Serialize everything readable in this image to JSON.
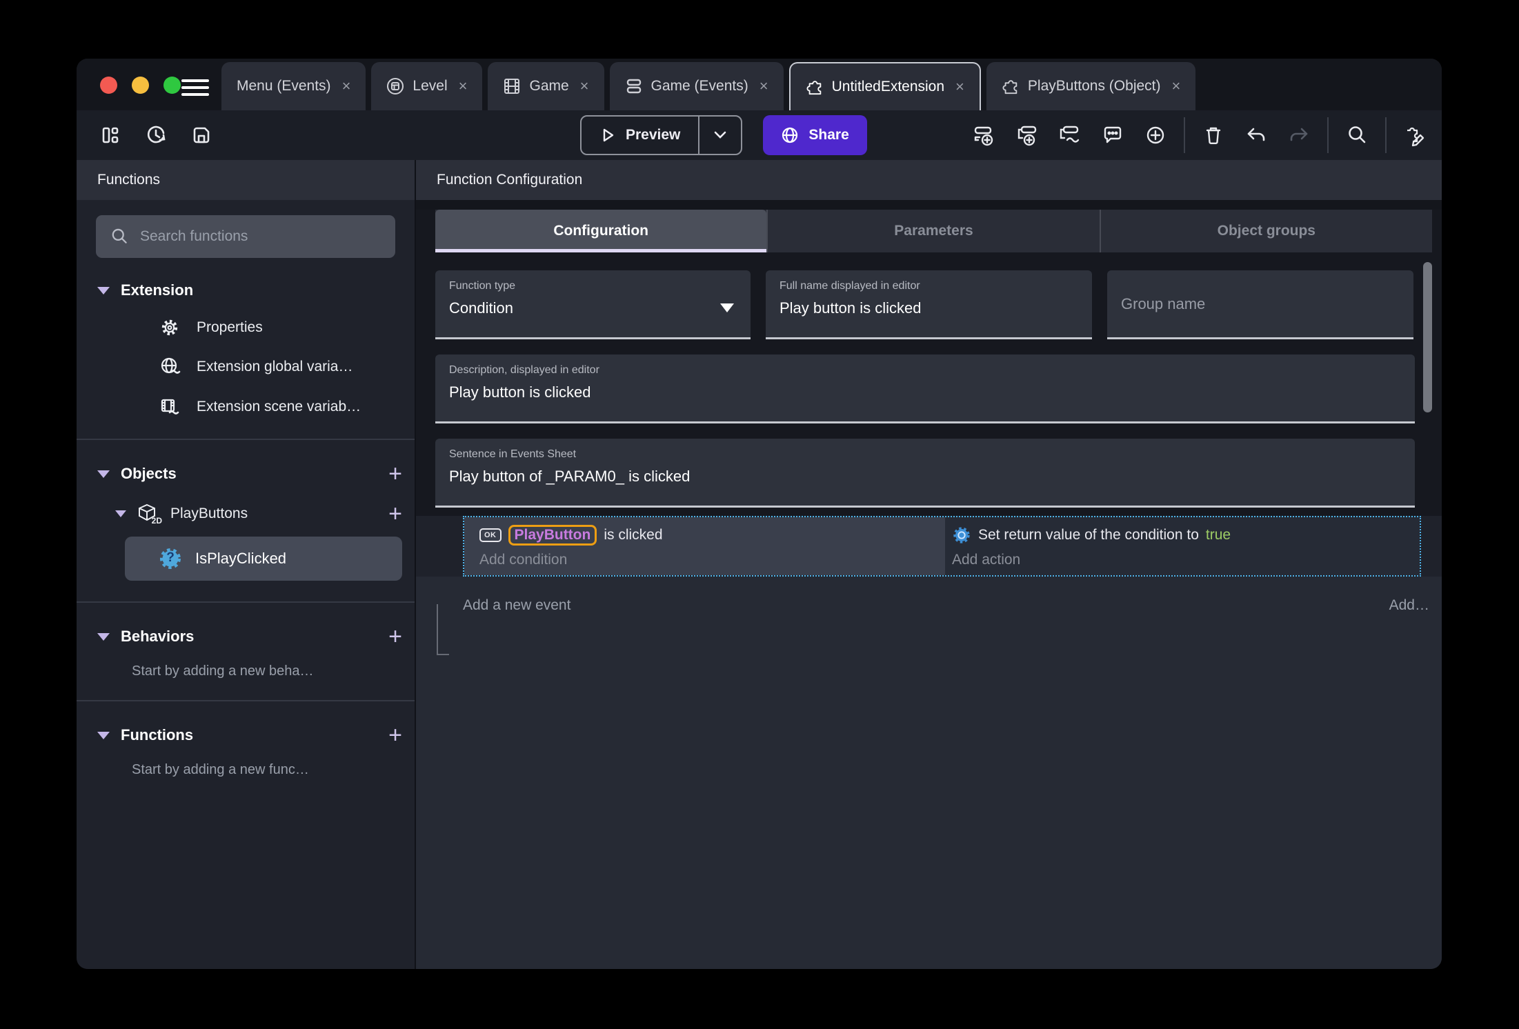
{
  "titlebar": {
    "tabs": [
      {
        "label": "Menu (Events)"
      },
      {
        "label": "Level"
      },
      {
        "label": "Game"
      },
      {
        "label": "Game (Events)"
      },
      {
        "label": "UntitledExtension"
      },
      {
        "label": "PlayButtons (Object)"
      }
    ]
  },
  "toolbar": {
    "preview": "Preview",
    "share": "Share"
  },
  "sidebar": {
    "title": "Functions",
    "search_placeholder": "Search functions",
    "sections": {
      "extension": {
        "label": "Extension"
      },
      "objects": {
        "label": "Objects"
      },
      "behaviors": {
        "label": "Behaviors",
        "hint": "Start by adding a new beha…"
      },
      "functions": {
        "label": "Functions",
        "hint": "Start by adding a new func…"
      }
    },
    "extension_items": [
      {
        "label": "Properties"
      },
      {
        "label": "Extension global varia…"
      },
      {
        "label": "Extension scene variab…"
      }
    ],
    "objects_tree": {
      "object": "PlayButtons",
      "function": "IsPlayClicked"
    }
  },
  "main": {
    "title": "Function Configuration",
    "tabs": [
      {
        "label": "Configuration"
      },
      {
        "label": "Parameters"
      },
      {
        "label": "Object groups"
      }
    ],
    "fields": {
      "function_type": {
        "label": "Function type",
        "value": "Condition"
      },
      "full_name": {
        "label": "Full name displayed in editor",
        "value": "Play button is clicked"
      },
      "group_name": {
        "placeholder": "Group name"
      },
      "description": {
        "label": "Description, displayed in editor",
        "value": "Play button is clicked"
      },
      "sentence": {
        "label": "Sentence in Events Sheet",
        "value": "Play button of _PARAM0_ is clicked"
      }
    },
    "events": {
      "condition_object": "PlayButton",
      "condition_text": "is clicked",
      "add_condition": "Add condition",
      "action_text": "Set return value of the condition to",
      "action_value": "true",
      "add_action": "Add action",
      "add_event": "Add a new event",
      "add_more": "Add…"
    }
  },
  "icons": {
    "add": "+",
    "close": "×",
    "ok_badge": "OK",
    "question": "?",
    "cube_2d": "2D"
  },
  "colors": {
    "share_button": "#4F28CD",
    "event_selection": "#4FB3E8",
    "object_name": "#C87BE0",
    "object_highlight": "#ED9E13",
    "true_green": "#9CCC65"
  }
}
